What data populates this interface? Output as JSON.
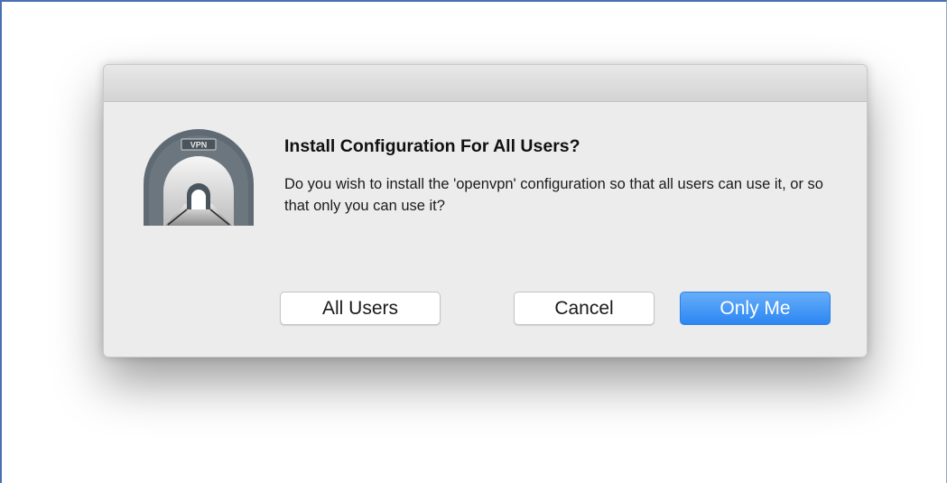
{
  "dialog": {
    "icon": "vpn-tunnel-icon",
    "icon_label": "VPN",
    "title": "Install Configuration For All Users?",
    "message": "Do you wish to install the 'openvpn' configuration so that all users can use it, or so that only you can use it?",
    "buttons": {
      "all_users": "All Users",
      "cancel": "Cancel",
      "only_me": "Only Me"
    },
    "colors": {
      "primary_button": "#2c86f2",
      "background": "#ececec",
      "icon_arch": "#5f6a74"
    }
  }
}
